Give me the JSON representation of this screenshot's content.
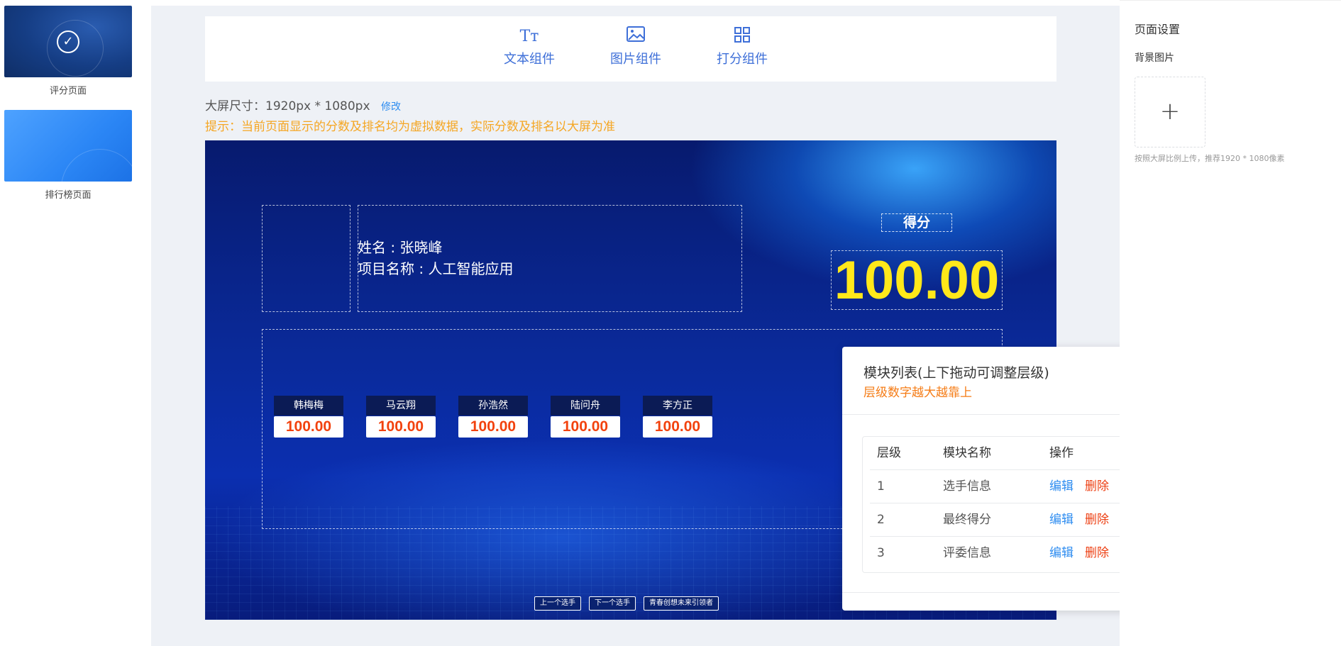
{
  "pages": [
    {
      "label": "评分页面",
      "active": true
    },
    {
      "label": "排行榜页面",
      "active": false
    }
  ],
  "toolbar": {
    "text_component": "文本组件",
    "image_component": "图片组件",
    "score_component": "打分组件"
  },
  "screen_size": {
    "label": "大屏尺寸：1920px * 1080px",
    "edit": "修改"
  },
  "tip": "提示：当前页面显示的分数及排名均为虚拟数据，实际分数及排名以大屏为准",
  "canvas": {
    "contestant_name": "姓名 : 张晓峰",
    "project_name": "项目名称 : 人工智能应用",
    "score_label": "得分",
    "score_value": "100.00",
    "judges": [
      {
        "name": "韩梅梅",
        "score": "100.00"
      },
      {
        "name": "马云翔",
        "score": "100.00"
      },
      {
        "name": "孙浩然",
        "score": "100.00"
      },
      {
        "name": "陆问舟",
        "score": "100.00"
      },
      {
        "name": "李方正",
        "score": "100.00"
      }
    ],
    "buttons": {
      "prev": "上一个选手",
      "next": "下一个选手",
      "third": "青春创想未来引领者"
    }
  },
  "module_popup": {
    "title": "模块列表(上下拖动可调整层级)",
    "subtitle": "层级数字越大越靠上",
    "headers": {
      "level": "层级",
      "name": "模块名称",
      "action": "操作"
    },
    "rows": [
      {
        "level": "1",
        "name": "选手信息",
        "edit": "编辑",
        "delete": "删除"
      },
      {
        "level": "2",
        "name": "最终得分",
        "edit": "编辑",
        "delete": "删除"
      },
      {
        "level": "3",
        "name": "评委信息",
        "edit": "编辑",
        "delete": "删除"
      }
    ]
  },
  "settings": {
    "title": "页面设置",
    "bg_label": "背景图片",
    "upload_icon": "+",
    "hint": "按照大屏比例上传，推荐1920 * 1080像素"
  }
}
